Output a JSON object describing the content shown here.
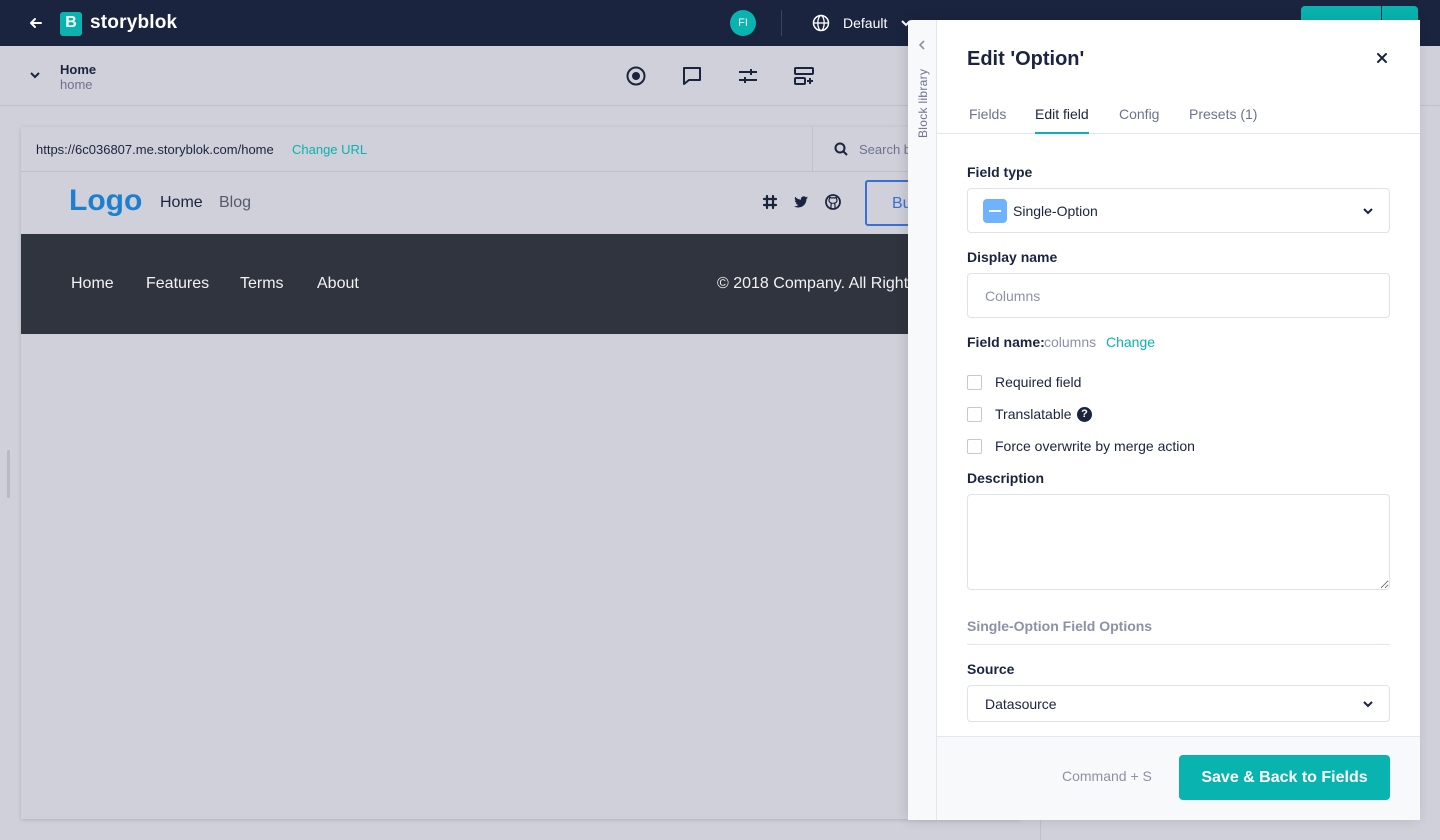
{
  "topbar": {
    "brand": "storyblok",
    "logo_letter": "B",
    "avatar_initials": "FI",
    "language": "Default",
    "icons": [
      "arrow-left-icon",
      "globe-icon",
      "chevron-down-icon"
    ]
  },
  "subbar": {
    "story_title": "Home",
    "story_slug": "home",
    "tools": [
      "target-icon",
      "comment-icon",
      "sliders-icon",
      "add-block-icon"
    ]
  },
  "preview": {
    "url": "https://6c036807.me.storyblok.com/home",
    "change_url": "Change URL",
    "search_placeholder": "Search b",
    "site": {
      "logo": "Logo",
      "nav": [
        "Home",
        "Blog"
      ],
      "button_partial": "Bu",
      "social_icons": [
        "slack-icon",
        "twitter-icon",
        "github-icon"
      ]
    },
    "footer": {
      "links": [
        "Home",
        "Features",
        "Terms",
        "About"
      ],
      "copyright": "© 2018 Company. All Right"
    }
  },
  "modal": {
    "block_library": "Block library",
    "title": "Edit 'Option'",
    "tabs": [
      "Fields",
      "Edit field",
      "Config",
      "Presets (1)"
    ],
    "active_tab": "Edit field",
    "field_type_label": "Field type",
    "field_type_value": "Single-Option",
    "display_name_label": "Display name",
    "display_name_placeholder": "Columns",
    "field_name_label": "Field name:",
    "field_name_value": "columns",
    "field_name_change": "Change",
    "checkboxes": [
      {
        "label": "Required field",
        "checked": false
      },
      {
        "label": "Translatable",
        "checked": false
      },
      {
        "label": "Force overwrite by merge action",
        "checked": false
      }
    ],
    "description_label": "Description",
    "section_title": "Single-Option Field Options",
    "source_label": "Source",
    "source_value": "Datasource",
    "shortcut": "Command + S",
    "save_button": "Save & Back to Fields"
  },
  "colors": {
    "topbar": "#1b243f",
    "accent": "#09b3af",
    "overlay": "#cfd0d9",
    "footer": "#30343e",
    "site_logo": "#1f7fcf"
  }
}
